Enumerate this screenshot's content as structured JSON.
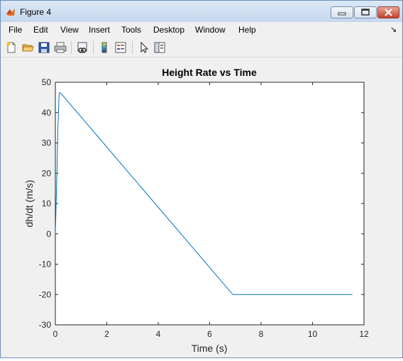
{
  "window": {
    "title": "Figure 4"
  },
  "menu": {
    "items": [
      "File",
      "Edit",
      "View",
      "Insert",
      "Tools",
      "Desktop",
      "Window",
      "Help"
    ]
  },
  "toolbar": {
    "icons": [
      "new-figure-icon",
      "open-file-icon",
      "save-icon",
      "print-icon",
      "link-plot-icon",
      "colorbar-icon",
      "legend-icon",
      "pointer-icon",
      "property-editor-icon"
    ]
  },
  "colors": {
    "line": "#0072bd",
    "titlebar": "#c5d7ee",
    "axes_bg": "#ffffff"
  },
  "chart_data": {
    "type": "line",
    "title": "Height Rate vs Time",
    "xlabel": "Time (s)",
    "ylabel": "dh/dt (m/s)",
    "xlim": [
      0,
      12
    ],
    "ylim": [
      -30,
      50
    ],
    "xticks": [
      0,
      2,
      4,
      6,
      8,
      10,
      12
    ],
    "yticks": [
      -30,
      -20,
      -10,
      0,
      10,
      20,
      30,
      40,
      50
    ],
    "grid": false,
    "series": [
      {
        "x": [
          0,
          0.03,
          0.06,
          0.1,
          0.15,
          0.2,
          6.9,
          11.55
        ],
        "y": [
          0,
          10,
          20,
          35,
          46.5,
          46.5,
          -20,
          -20
        ]
      }
    ]
  }
}
